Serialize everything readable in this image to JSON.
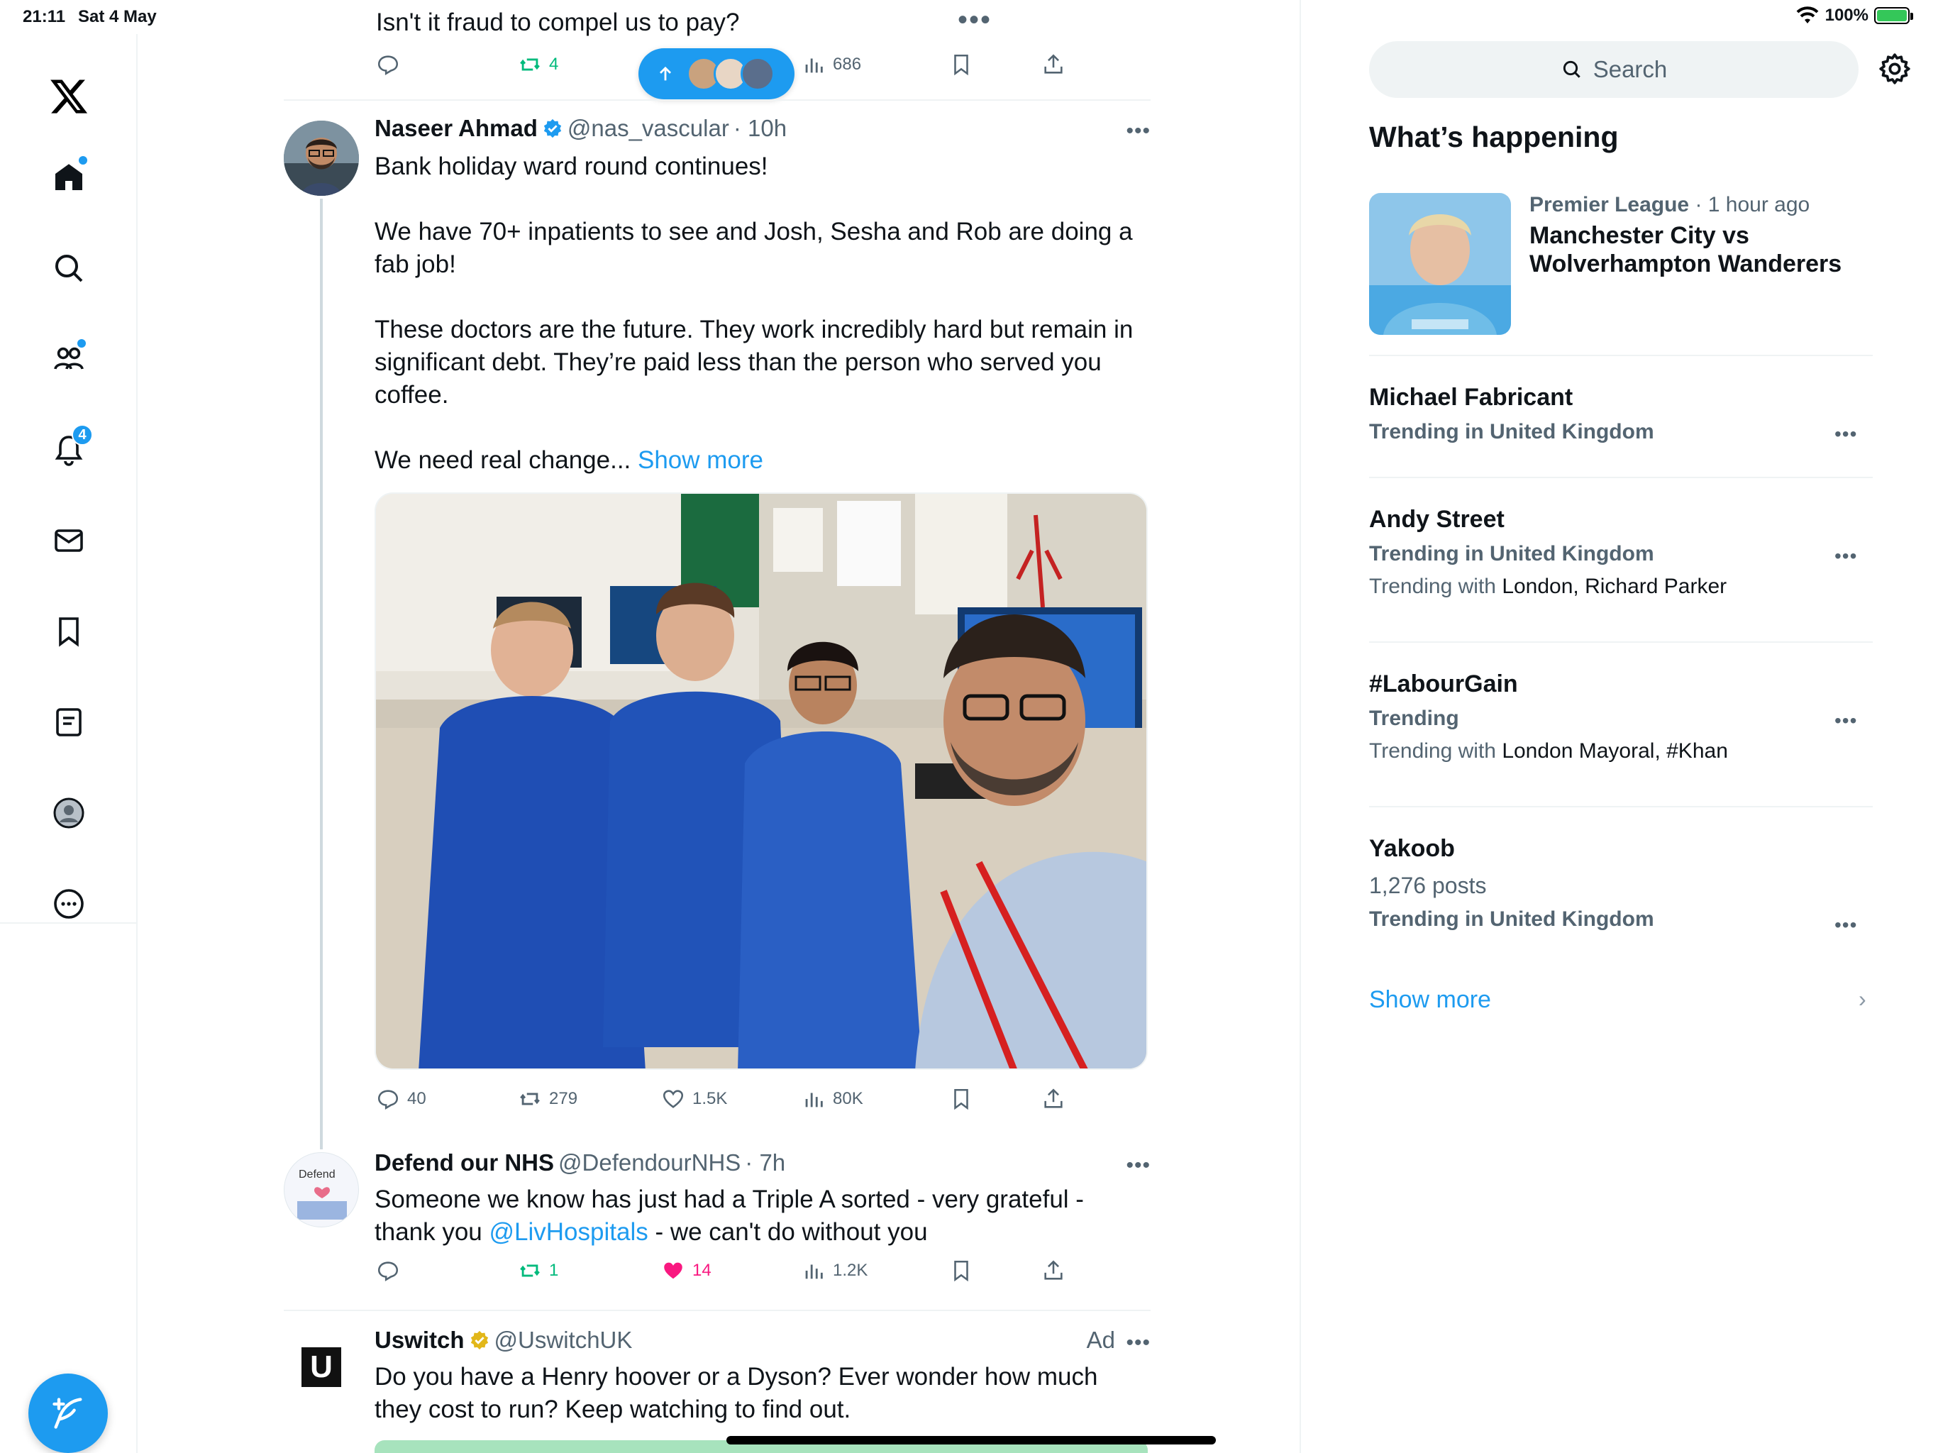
{
  "status_bar": {
    "time": "21:11",
    "date": "Sat 4 May",
    "battery": "100%",
    "battery_level": 1.0
  },
  "nav": {
    "notifications_badge": "4"
  },
  "prev_tweet": {
    "text": "Isn't it fraud to compel us to pay?",
    "retweets": "4",
    "views": "686"
  },
  "tweet1": {
    "name": "Naseer Ahmad",
    "handle": "@nas_vascular",
    "time": "· 10h",
    "para1": "Bank holiday ward round continues!",
    "para2": "We have 70+ inpatients to see and Josh, Sesha and Rob are doing a fab job!",
    "para3": "These doctors are the future.  They work incredibly hard but remain in significant debt.  They’re paid less than the person who served you coffee.",
    "para4": "We need real change...",
    "show_more": "Show more",
    "replies": "40",
    "retweets": "279",
    "likes": "1.5K",
    "views": "80K"
  },
  "tweet2": {
    "name": "Defend our NHS",
    "handle": "@DefendourNHS",
    "time": "· 7h",
    "avatar_text": "Defend",
    "text_a": "Someone we know has just had a Triple A sorted -  very grateful - thank you ",
    "mention": "@LivHospitals",
    "text_b": " - we can't do without you",
    "retweets": "1",
    "likes": "14",
    "views": "1.2K"
  },
  "tweet3": {
    "name": "Uswitch",
    "handle": "@UswitchUK",
    "ad_label": "Ad",
    "avatar_letter": "U",
    "text": "Do you have a Henry hoover or a Dyson? Ever wonder how much they cost to run? Keep watching to find out."
  },
  "sidebar": {
    "search_placeholder": "Search",
    "section_title": "What’s happening",
    "featured": {
      "category": "Premier League",
      "time": " · 1 hour ago",
      "title": "Manchester City vs Wolverhampton Wanderers"
    },
    "trends": [
      {
        "title": "Michael Fabricant",
        "sub": "Trending in United Kingdom"
      },
      {
        "title": "Andy Street",
        "sub": "Trending in United Kingdom",
        "with_label": "Trending with ",
        "with_value": "London, Richard Parker"
      },
      {
        "title": "#LabourGain",
        "sub": "Trending",
        "with_label": "Trending with ",
        "with_value": "London Mayoral, #Khan"
      },
      {
        "title": "Yakoob",
        "posts": "1,276 posts",
        "sub": "Trending in United Kingdom"
      }
    ],
    "show_more": "Show more"
  },
  "colors": {
    "accent": "#1d9bf0",
    "text": "#0f1419",
    "muted": "#536471",
    "retweet_green": "#00ba7c",
    "like_pink": "#f91880"
  }
}
